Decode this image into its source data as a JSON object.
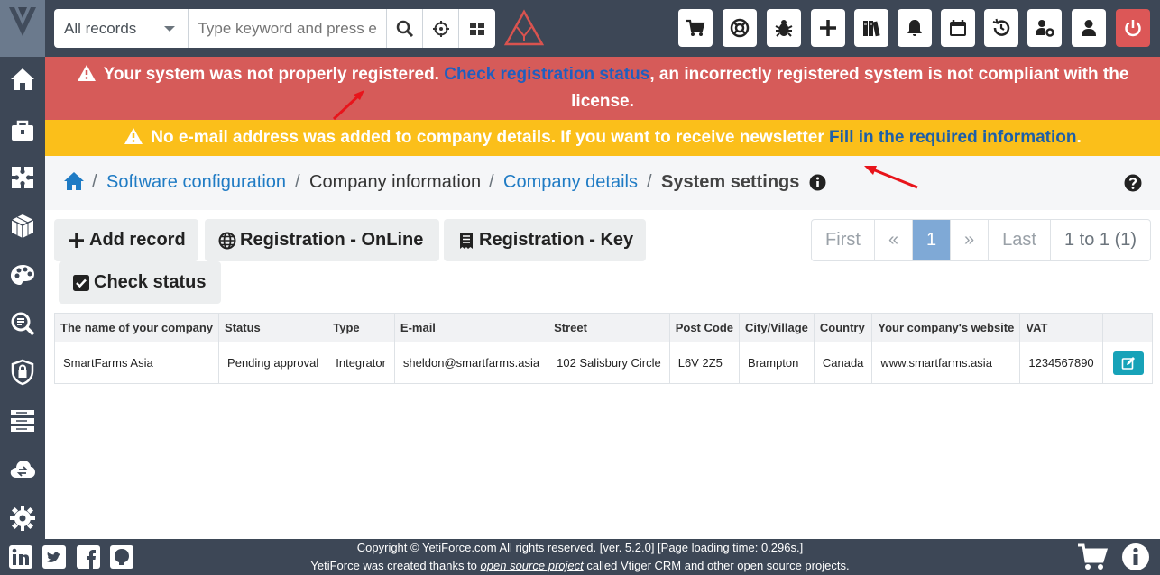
{
  "header": {
    "record_select": "All records",
    "search_placeholder": "Type keyword and press enter",
    "icons": [
      "cart-icon",
      "life-ring-icon",
      "bug-icon",
      "plus-icon",
      "books-icon",
      "bell-icon",
      "calendar-icon",
      "history-icon",
      "user-gear-icon",
      "user-icon",
      "power-icon"
    ]
  },
  "sidebar": {
    "icons": [
      "home-icon",
      "briefcase-icon",
      "puzzle-icon",
      "cube-icon",
      "palette-icon",
      "search-report-icon",
      "shield-lock-icon",
      "server-icon",
      "cloud-icon",
      "gears-icon"
    ]
  },
  "alerts": {
    "red": {
      "text_before": "Your system was not properly registered.",
      "link": "Check registration status",
      "text_after": ", an incorrectly registered system is not compliant with the license."
    },
    "yellow": {
      "text_before": "No e-mail address was added to company details. If you want to receive newsletter",
      "link": "Fill in the required information",
      "text_after": "."
    }
  },
  "breadcrumb": {
    "items": [
      "Software configuration",
      "Company information",
      "Company details",
      "System settings"
    ],
    "separator": "/"
  },
  "actions": {
    "add_record": "Add record",
    "registration_online": "Registration - OnLine",
    "registration_key": "Registration - Key",
    "check_status": "Check status"
  },
  "pagination": {
    "first": "First",
    "prev": "«",
    "current": "1",
    "next": "»",
    "last": "Last",
    "count": "1 to 1 (1)"
  },
  "table": {
    "columns": [
      "The name of your company",
      "Status",
      "Type",
      "E-mail",
      "Street",
      "Post Code",
      "City/Village",
      "Country",
      "Your company's website",
      "VAT"
    ],
    "rows": [
      [
        "SmartFarms Asia",
        "Pending approval",
        "Integrator",
        "sheldon@smartfarms.asia",
        "102 Salisbury Circle",
        "L6V 2Z5",
        "Brampton",
        "Canada",
        "www.smartfarms.asia",
        "1234567890"
      ]
    ]
  },
  "footer": {
    "line1": "Copyright © YetiForce.com All rights reserved. [ver. 5.2.0] [Page loading time: 0.296s.]",
    "line2_before": "YetiForce was created thanks to",
    "line2_link": "open source project",
    "line2_after": "called Vtiger CRM and other open source projects."
  },
  "colors": {
    "dark": "#3d4756",
    "danger": "#d65b59",
    "warning": "#fbbf1a",
    "link": "#1f7bc4",
    "active_page": "#7fa9d6",
    "edit": "#17a2b8"
  }
}
